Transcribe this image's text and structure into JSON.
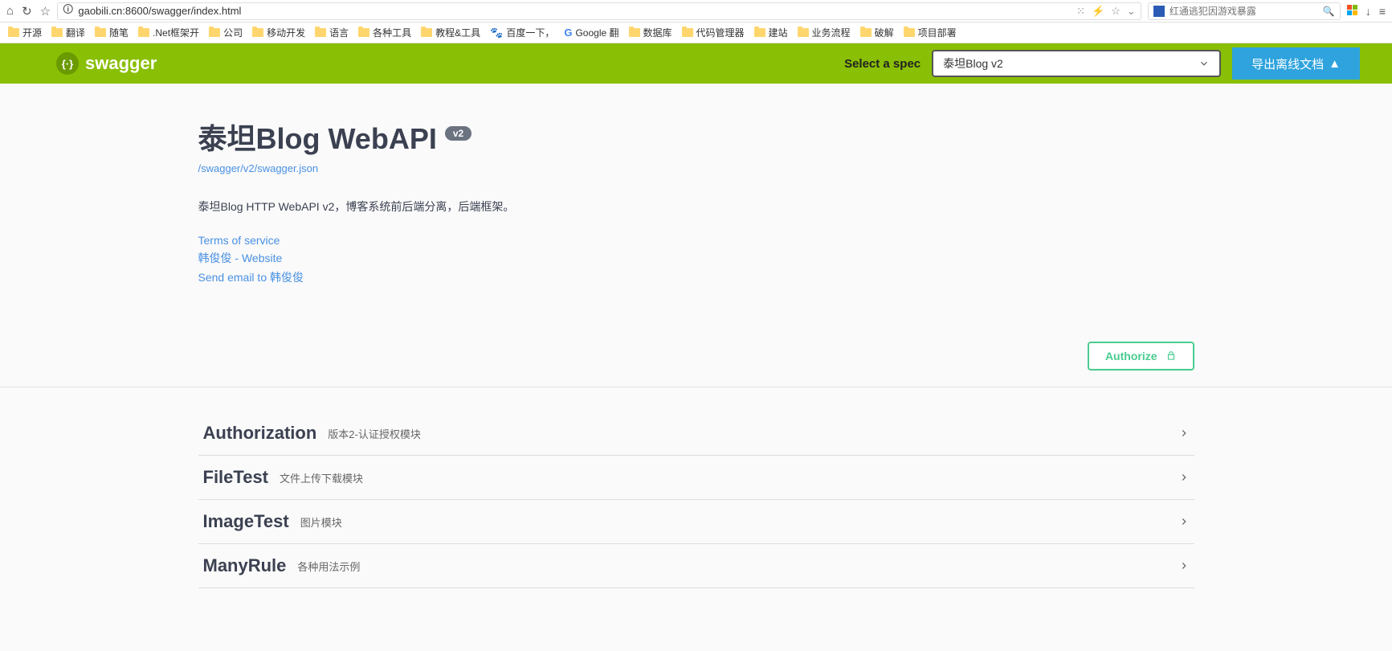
{
  "browser": {
    "url": "gaobili.cn:8600/swagger/index.html",
    "search_placeholder": "红通逃犯因游戏暴露"
  },
  "bookmarks": [
    {
      "type": "folder",
      "label": "开源"
    },
    {
      "type": "folder",
      "label": "翻译"
    },
    {
      "type": "folder",
      "label": "随笔"
    },
    {
      "type": "folder",
      "label": ".Net框架开"
    },
    {
      "type": "folder",
      "label": "公司"
    },
    {
      "type": "folder",
      "label": "移动开发"
    },
    {
      "type": "folder",
      "label": "语言"
    },
    {
      "type": "folder",
      "label": "各种工具"
    },
    {
      "type": "folder",
      "label": "教程&工具"
    },
    {
      "type": "paw",
      "label": "百度一下，"
    },
    {
      "type": "g",
      "label": "Google 翻"
    },
    {
      "type": "folder",
      "label": "数据库"
    },
    {
      "type": "folder",
      "label": "代码管理器"
    },
    {
      "type": "folder",
      "label": "建站"
    },
    {
      "type": "folder",
      "label": "业务流程"
    },
    {
      "type": "folder",
      "label": "破解"
    },
    {
      "type": "folder",
      "label": "项目部署"
    }
  ],
  "topbar": {
    "brand": "swagger",
    "select_label": "Select a spec",
    "selected_spec": "泰坦Blog v2",
    "export_label": "导出离线文档"
  },
  "info": {
    "title": "泰坦Blog WebAPI",
    "version": "v2",
    "spec_link": "/swagger/v2/swagger.json",
    "description": "泰坦Blog HTTP WebAPI v2，博客系统前后端分离，后端框架。",
    "terms": "Terms of service",
    "website": "韩俊俊 - Website",
    "email": "Send email to 韩俊俊"
  },
  "authorize_label": "Authorize",
  "tags": [
    {
      "name": "Authorization",
      "desc": "版本2-认证授权模块"
    },
    {
      "name": "FileTest",
      "desc": "文件上传下载模块"
    },
    {
      "name": "ImageTest",
      "desc": "图片模块"
    },
    {
      "name": "ManyRule",
      "desc": "各种用法示例"
    }
  ]
}
